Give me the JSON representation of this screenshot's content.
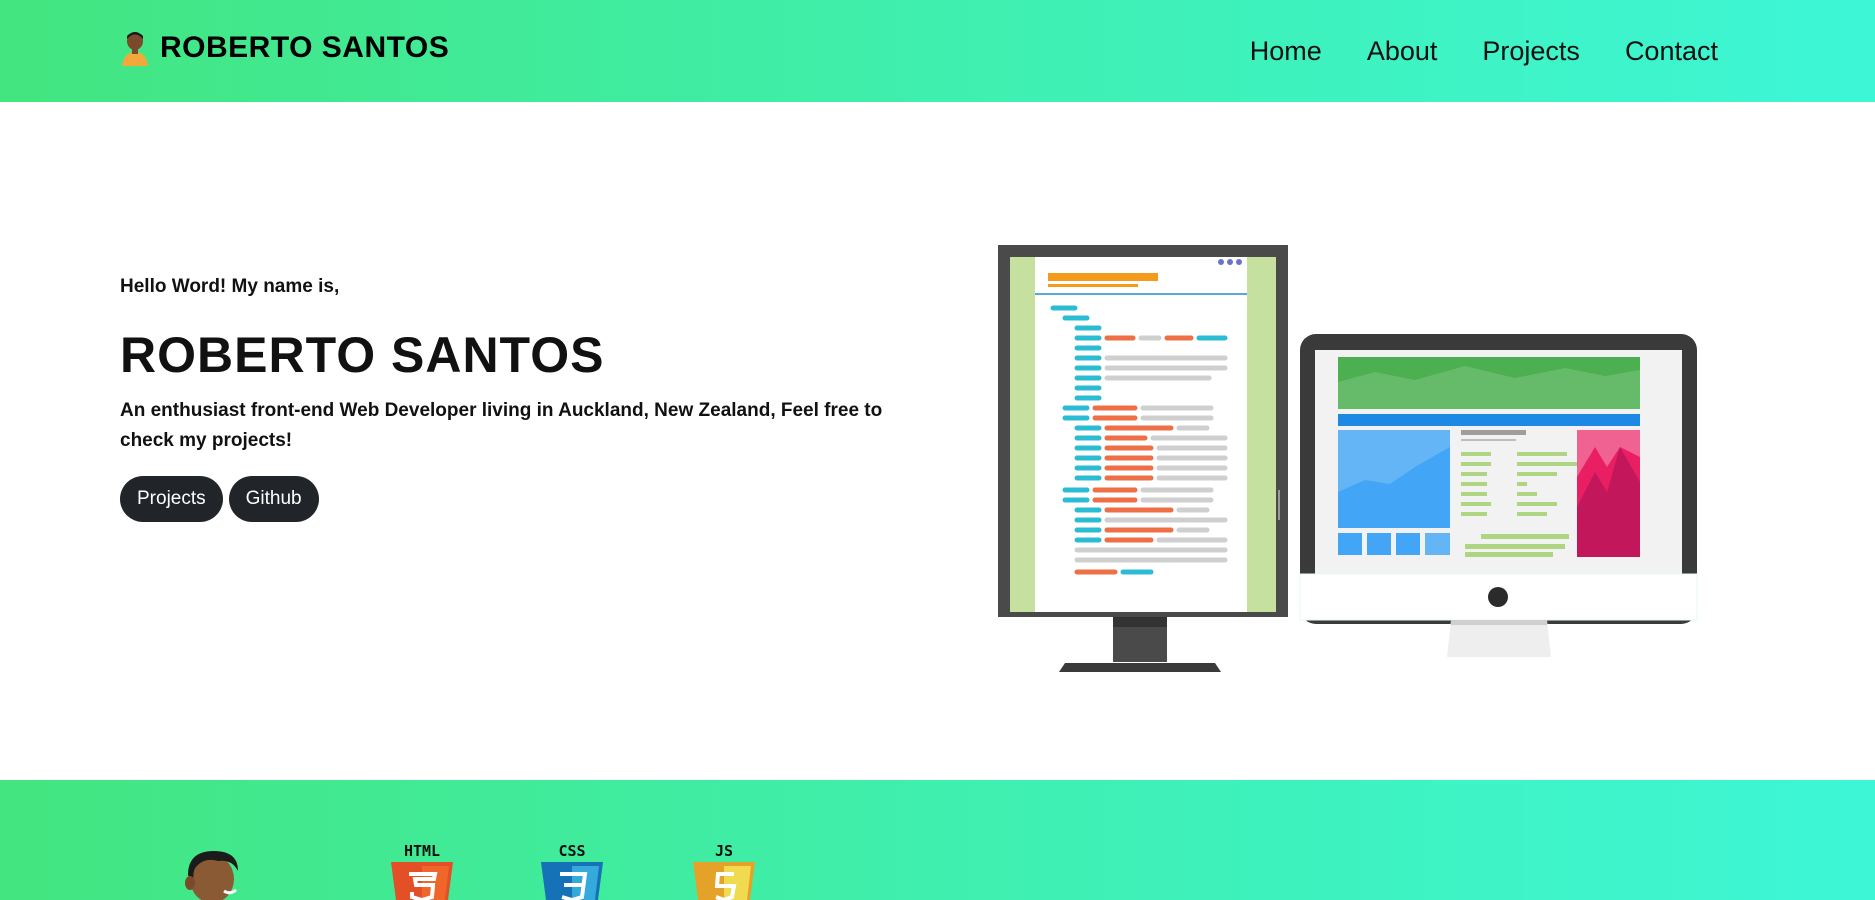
{
  "navbar": {
    "brand_icon": "developer-avatar-icon",
    "brand_name": "ROBERTO SANTOS",
    "links": [
      "Home",
      "About",
      "Projects",
      "Contact"
    ]
  },
  "hero": {
    "greeting": "Hello Word! My name is,",
    "name": "ROBERTO SANTOS",
    "description": "An enthusiast front-end Web Developer living in Auckland, New Zealand, Feel free to check my projects!",
    "buttons": [
      "Projects",
      "Github"
    ],
    "illustration": "code-editor-and-desktop-illustration"
  },
  "skills": {
    "avatar_icon": "developer-avatar-icon",
    "logos": [
      "HTML",
      "CSS",
      "JS"
    ]
  },
  "colors": {
    "gradient_start": "#42e57f",
    "gradient_end": "#3df6d6",
    "button_bg": "#212529",
    "html_orange": "#e34f26",
    "css_blue": "#1572b6",
    "js_yellow": "#f0db4f"
  }
}
